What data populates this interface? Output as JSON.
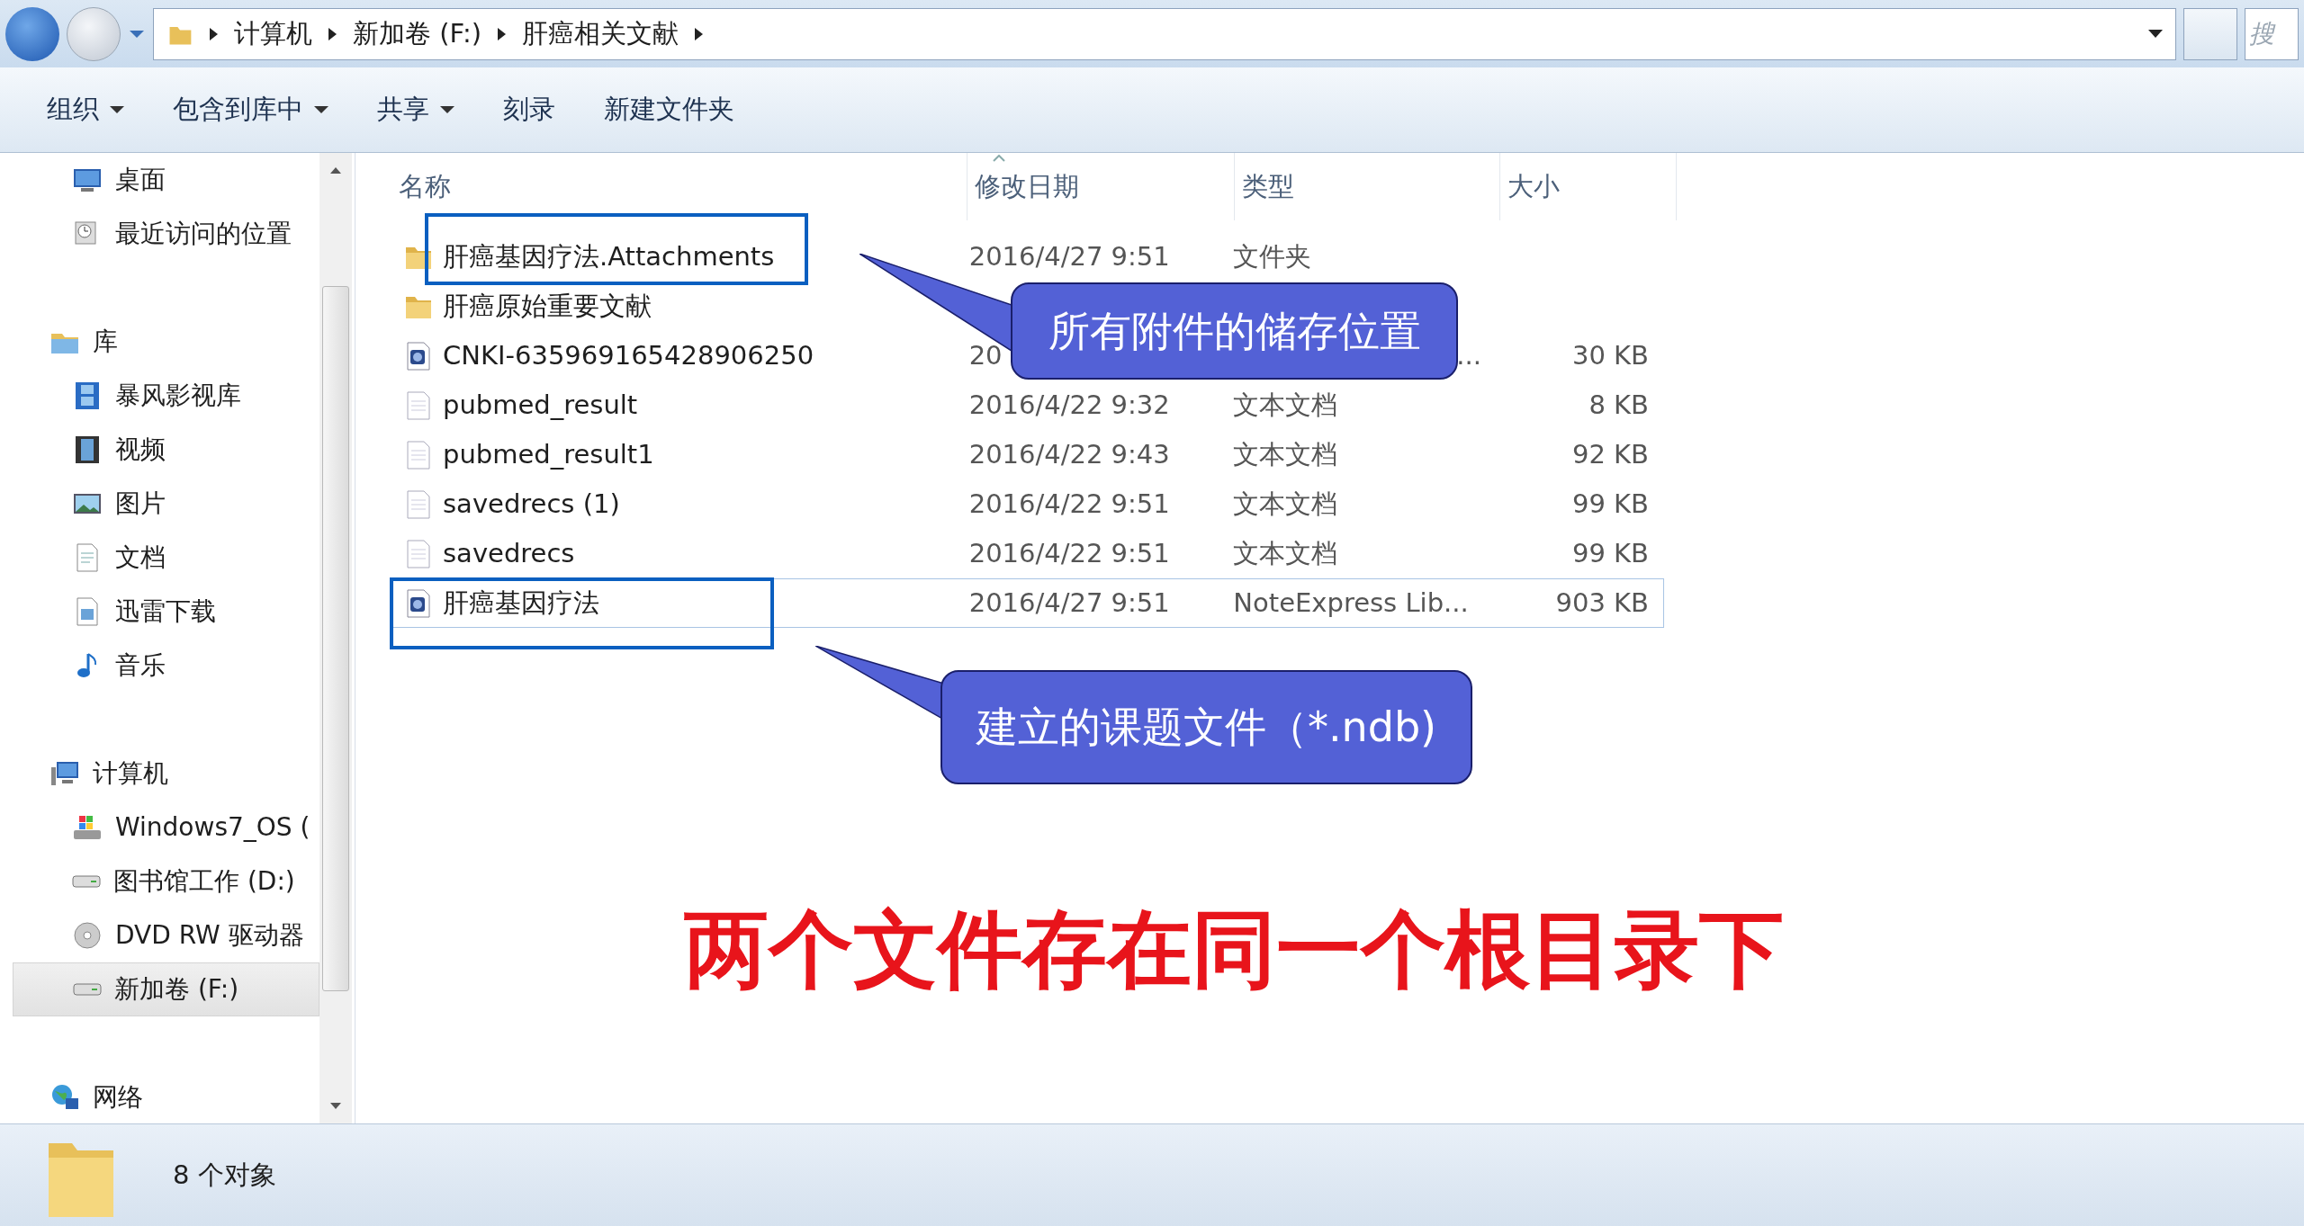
{
  "address_bar": {
    "breadcrumbs": [
      "计算机",
      "新加卷 (F:)",
      "肝癌相关文献"
    ]
  },
  "search": {
    "placeholder": "搜"
  },
  "toolbar": [
    {
      "label": "组织",
      "dropdown": true
    },
    {
      "label": "包含到库中",
      "dropdown": true
    },
    {
      "label": "共享",
      "dropdown": true
    },
    {
      "label": "刻录",
      "dropdown": false
    },
    {
      "label": "新建文件夹",
      "dropdown": false
    }
  ],
  "sidebar": {
    "sections": [
      {
        "items": [
          {
            "label": "桌面",
            "selected": false
          },
          {
            "label": "最近访问的位置",
            "selected": false
          }
        ]
      },
      {
        "header": {
          "label": "库",
          "selected": false
        },
        "items": [
          {
            "label": "暴风影视库",
            "selected": false
          },
          {
            "label": "视频",
            "selected": false
          },
          {
            "label": "图片",
            "selected": false
          },
          {
            "label": "文档",
            "selected": false
          },
          {
            "label": "迅雷下载",
            "selected": false
          },
          {
            "label": "音乐",
            "selected": false
          }
        ]
      },
      {
        "header": {
          "label": "计算机",
          "selected": false
        },
        "items": [
          {
            "label": "Windows7_OS (",
            "selected": false
          },
          {
            "label": "图书馆工作 (D:)",
            "selected": false
          },
          {
            "label": "DVD RW 驱动器",
            "selected": false
          },
          {
            "label": "新加卷 (F:)",
            "selected": true
          }
        ]
      },
      {
        "header": {
          "label": "网络",
          "selected": false
        }
      }
    ]
  },
  "table": {
    "columns": [
      "名称",
      "修改日期",
      "类型",
      "大小"
    ],
    "rows": [
      {
        "kind": "folder",
        "name": "肝癌基因疗法.Attachments",
        "date": "2016/4/27 9:51",
        "type": "文件夹",
        "selected": false
      },
      {
        "kind": "folder",
        "name": "肝癌原始重要文献",
        "selected": false
      },
      {
        "kind": "library",
        "name": "CNKI-635969165428906250",
        "date": "20",
        "type": "...",
        "type_right_aligned": true,
        "size": "30 KB",
        "selected": false
      },
      {
        "kind": "text",
        "name": "pubmed_result",
        "date": "2016/4/22 9:32",
        "type": "文本文档",
        "size": "8 KB",
        "selected": false
      },
      {
        "kind": "text",
        "name": "pubmed_result1",
        "date": "2016/4/22 9:43",
        "type": "文本文档",
        "size": "92 KB",
        "selected": false
      },
      {
        "kind": "text",
        "name": "savedrecs (1)",
        "date": "2016/4/22 9:51",
        "type": "文本文档",
        "size": "99 KB",
        "selected": false
      },
      {
        "kind": "text",
        "name": "savedrecs",
        "date": "2016/4/22 9:51",
        "type": "文本文档",
        "size": "99 KB",
        "selected": false
      },
      {
        "kind": "library",
        "name": "肝癌基因疗法",
        "date": "2016/4/27 9:51",
        "type": "NoteExpress Lib...",
        "size": "903 KB",
        "selected": true
      }
    ]
  },
  "annotations": {
    "callouts": [
      "所有附件的储存位置",
      "建立的课题文件（*.ndb)"
    ],
    "caption": "两个文件存在同一个根目录下"
  },
  "status_bar": {
    "text": "8 个对象"
  }
}
